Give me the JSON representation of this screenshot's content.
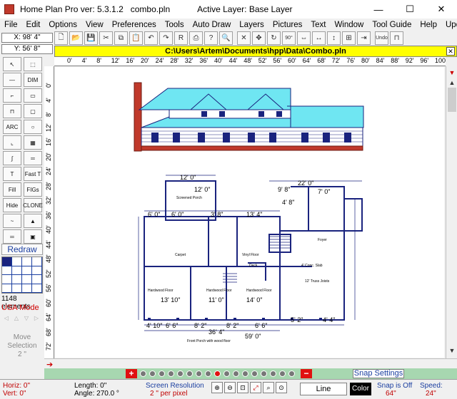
{
  "app": {
    "title": "Home Plan Pro ver: 5.3.1.2",
    "file": "combo.pln",
    "active_layer": "Active Layer: Base Layer",
    "minimize": "—",
    "maximize": "☐",
    "close": "✕"
  },
  "menu": [
    "File",
    "Edit",
    "Options",
    "View",
    "Preferences",
    "Tools",
    "Auto Draw",
    "Layers",
    "Pictures",
    "Text",
    "Window",
    "Tool Guide",
    "Help",
    "Updates"
  ],
  "toolbar": {
    "items": [
      {
        "icon": "new-file-icon",
        "glyph": "🗋"
      },
      {
        "icon": "open-folder-icon",
        "glyph": "📂"
      },
      {
        "icon": "save-icon",
        "glyph": "💾"
      },
      {
        "icon": "cut-icon",
        "glyph": "✂"
      },
      {
        "icon": "copy-icon",
        "glyph": "⧉"
      },
      {
        "icon": "paste-icon",
        "glyph": "📋"
      },
      {
        "icon": "undo-icon",
        "glyph": "↶"
      },
      {
        "icon": "redo-icon",
        "glyph": "↷"
      },
      {
        "icon": "print-preview-icon",
        "glyph": "R"
      },
      {
        "icon": "print-icon",
        "glyph": "⎙"
      },
      {
        "icon": "help-icon",
        "glyph": "?"
      },
      {
        "icon": "zoom-icon",
        "glyph": "🔍"
      },
      {
        "icon": "delete-icon",
        "glyph": "✕"
      },
      {
        "icon": "move-icon",
        "glyph": "✥"
      },
      {
        "icon": "rotate-icon",
        "glyph": "↻"
      },
      {
        "icon": "rotate-90-icon",
        "glyph": "90°"
      },
      {
        "icon": "mirror-icon",
        "glyph": "⇔"
      },
      {
        "icon": "flip-horizontal-icon",
        "glyph": "↔"
      },
      {
        "icon": "flip-vertical-icon",
        "glyph": "↕"
      },
      {
        "icon": "align-icon",
        "glyph": "⊞"
      },
      {
        "icon": "extend-icon",
        "glyph": "⇥"
      },
      {
        "icon": "undo-delete-icon",
        "glyph": "Undo"
      },
      {
        "icon": "magnet-icon",
        "glyph": "⊓"
      }
    ]
  },
  "coords": {
    "x": "X: 98' 4\"",
    "y": "Y: 56' 8\""
  },
  "path": "C:\\Users\\Artem\\Documents\\hpp\\Data\\Combo.pln",
  "path_close": "✕",
  "ruler": {
    "h_ticks": [
      "0'",
      "4'",
      "8'",
      "12'",
      "16'",
      "20'",
      "24'",
      "28'",
      "32'",
      "36'",
      "40'",
      "44'",
      "48'",
      "52'",
      "56'",
      "60'",
      "64'",
      "68'",
      "72'",
      "76'",
      "80'",
      "84'",
      "88'",
      "92'",
      "96'",
      "100'",
      "104'"
    ],
    "v_ticks": [
      "0'",
      "4'",
      "8'",
      "12'",
      "16'",
      "20'",
      "24'",
      "28'",
      "32'",
      "36'",
      "40'",
      "44'",
      "48'",
      "52'",
      "56'",
      "60'",
      "64'",
      "68'",
      "72'"
    ]
  },
  "left_tools": [
    {
      "icon": "select-arrow-icon",
      "glyph": "↖"
    },
    {
      "icon": "select-box-icon",
      "glyph": "⬚"
    },
    {
      "icon": "line-icon",
      "glyph": "—"
    },
    {
      "icon": "dimension-icon",
      "glyph": "DIM"
    },
    {
      "icon": "wall-corner-icon",
      "glyph": "⌐"
    },
    {
      "icon": "rectangle-icon",
      "glyph": "▭"
    },
    {
      "icon": "partial-box-icon",
      "glyph": "⊓"
    },
    {
      "icon": "rounded-box-icon",
      "glyph": "▢"
    },
    {
      "icon": "arc-icon",
      "glyph": "ARC"
    },
    {
      "icon": "circle-icon",
      "glyph": "○"
    },
    {
      "icon": "corner-wall-icon",
      "glyph": "⌞"
    },
    {
      "icon": "window-icon",
      "glyph": "▦"
    },
    {
      "icon": "curve-icon",
      "glyph": "∫"
    },
    {
      "icon": "double-line-icon",
      "glyph": "═"
    },
    {
      "icon": "text-icon",
      "glyph": "T"
    },
    {
      "icon": "fast-text-icon",
      "glyph": "Fast T"
    },
    {
      "icon": "fill-icon",
      "glyph": "Fill"
    },
    {
      "icon": "figures-icon",
      "glyph": "FIGs"
    },
    {
      "icon": "hide-icon",
      "glyph": "Hide"
    },
    {
      "icon": "clone-icon",
      "glyph": "CLONE"
    },
    {
      "icon": "spline-icon",
      "glyph": "~"
    },
    {
      "icon": "landscape-icon",
      "glyph": "▲"
    },
    {
      "icon": "hline-icon",
      "glyph": "═"
    },
    {
      "icon": "frame-icon",
      "glyph": "▣"
    }
  ],
  "left_panel": {
    "redraw": "Redraw",
    "elements": "1148 elements",
    "usa_mode": "USA Mode",
    "move_selection": "Move Selection",
    "move_amount": "2 \""
  },
  "pages": {
    "add": "+",
    "remove": "−",
    "dots_before": 8,
    "dots_after": 8,
    "snap_settings": "Snap Settings"
  },
  "status": {
    "horiz": "Horiz:  0\"",
    "vert": "Vert:  0\"",
    "length": "Length:  0\"",
    "angle": "Angle:  270.0 °",
    "screen_res_label": "Screen Resolution",
    "screen_res_value": "2 \" per pixel",
    "line": "Line",
    "color": "Color",
    "snap_label": "Snap is Off",
    "snap_value": "64\"",
    "speed_label": "Speed:",
    "speed_value": "24\""
  },
  "drawing": {
    "elevation_labels": [],
    "plan_dims": [
      "12' 0\"",
      "22' 0\"",
      "9' 8\"",
      "7' 0\"",
      "4' 8\"",
      "12' 0\"",
      "13' 4\"",
      "6' 0\"",
      "6' 0\"",
      "3' 8\"",
      "13' 10\"",
      "11' 0\"",
      "14' 0\"",
      "36' 4\"",
      "59' 0\"",
      "4' 10\"",
      "6' 6\"",
      "8' 2\"",
      "8' 2\"",
      "6' 6\"",
      "5' 2\"",
      "4' 4\""
    ],
    "room_labels": [
      "Screened Porch",
      "Carpet",
      "Vinyl Floor",
      "Foyer",
      "Hardwood Floor",
      "Hardwood Floor",
      "Hardwood Floor",
      "4' Conc. Slab",
      "12' Truss Joists",
      "Front Porch with wood floor",
      "Deck"
    ]
  }
}
